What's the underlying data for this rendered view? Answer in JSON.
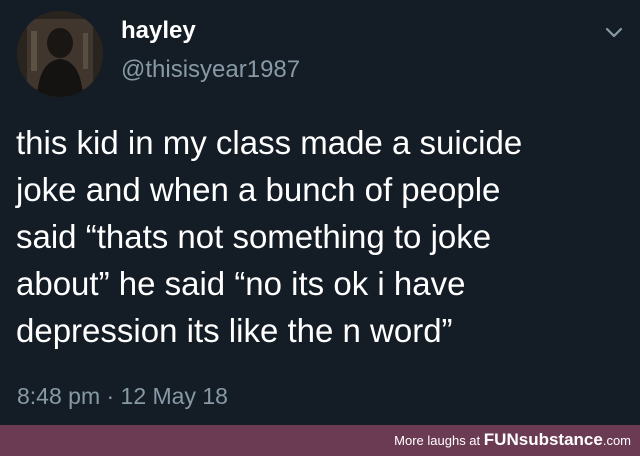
{
  "tweet": {
    "author_name": "hayley",
    "author_handle": "@thisisyear1987",
    "text_lines": [
      "this kid in my class made a suicide",
      "joke and when a bunch of people",
      "said “thats not something to joke",
      "about” he said “no its ok i have",
      "depression its like the n word”"
    ],
    "timestamp": "8:48 pm · 12 May 18",
    "menu_icon": "chevron-down-icon"
  },
  "footer": {
    "prefix": "More laughs at",
    "brand_main": "FUN",
    "brand_sub": "substance",
    "brand_suffix": ".com"
  },
  "colors": {
    "background": "#141d26",
    "primary_text": "#ffffff",
    "secondary_text": "#8899a6",
    "footer_bg": "#6b3b54"
  }
}
